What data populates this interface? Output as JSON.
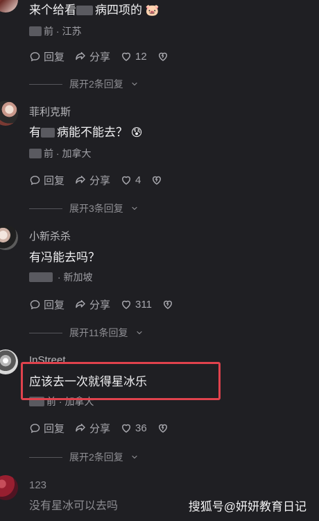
{
  "comments": [
    {
      "text_prefix": "来个给看",
      "text_suffix": "病四项的",
      "emoji": "🐷",
      "meta_suffix": "前 · 江苏",
      "reply": "回复",
      "share": "分享",
      "likes": "12",
      "expand": "展开2条回复"
    },
    {
      "name": "菲利克斯",
      "text_prefix": "有",
      "text_suffix": "病能不能去？",
      "emoji": "😰",
      "meta_suffix": "前 · 加拿大",
      "reply": "回复",
      "share": "分享",
      "likes": "4",
      "expand": "展开3条回复"
    },
    {
      "name": "小新杀杀",
      "text": "有冯能去吗？",
      "meta_suffix": " · 新加坡",
      "reply": "回复",
      "share": "分享",
      "likes": "311",
      "expand": "展开11条回复"
    },
    {
      "name": "InStreet",
      "text": "应该去一次就得星冰乐",
      "meta_suffix": "前 · 加拿大",
      "reply": "回复",
      "share": "分享",
      "likes": "36",
      "expand": "展开2条回复"
    },
    {
      "name": "123",
      "text": "没有星冰可以去吗"
    }
  ],
  "watermark": "搜狐号@妍妍教育日记",
  "colors": {
    "background": "#1f1f23",
    "text": "#f0f0f2",
    "muted": "#a0a0a6",
    "highlight": "#e0424d"
  },
  "icons": {
    "reply": "reply-icon",
    "share": "share-icon",
    "like": "heart-icon",
    "dislike": "broken-heart-icon",
    "expand": "chevron-down-icon"
  }
}
